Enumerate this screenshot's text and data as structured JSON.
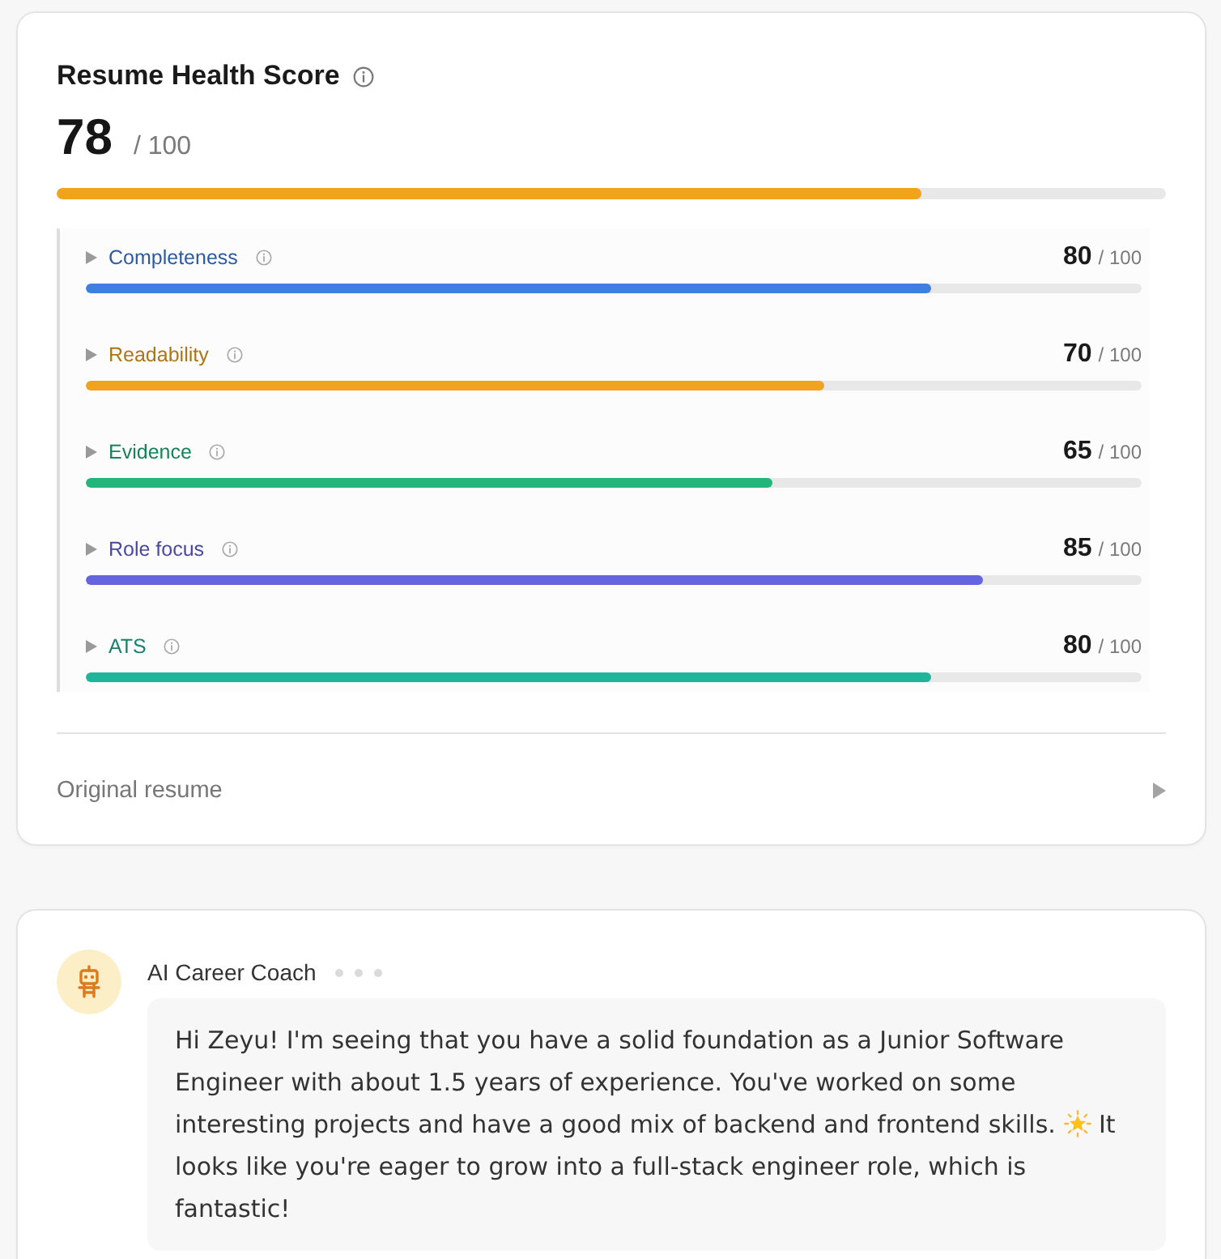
{
  "score_card": {
    "title": "Resume Health Score",
    "score": "78",
    "max": "/ 100",
    "level": 0.78,
    "categories": [
      {
        "name": "Completeness",
        "score": "80",
        "max": "/ 100",
        "level": 0.8,
        "color": "#3f7fe0",
        "expanded": false
      },
      {
        "name": "Readability",
        "score": "70",
        "max": "/ 100",
        "level": 0.7,
        "color": "#f0a320",
        "expanded": false
      },
      {
        "name": "Evidence",
        "score": "65",
        "max": "/ 100",
        "level": 0.65,
        "color": "#22b67b",
        "expanded": false
      },
      {
        "name": "Role focus",
        "score": "85",
        "max": "/ 100",
        "level": 0.85,
        "color": "#6565e0",
        "expanded": false
      },
      {
        "name": "ATS",
        "score": "80",
        "max": "/ 100",
        "level": 0.8,
        "color": "#20b49b",
        "expanded": false
      }
    ],
    "footer": {
      "label": "Original resume",
      "expanded": false
    }
  },
  "chat": {
    "sender": "AI Career Coach",
    "typing": true,
    "message": [
      {
        "kind": "text",
        "text": "Hi Zeyu! I'm seeing that you have a solid foundation as a Junior Software Engineer with about 1.5 years of experience. You've worked on some interesting projects and have a good mix of backend and frontend skills."
      },
      {
        "kind": "emoji"
      },
      {
        "kind": "text",
        "text": "It looks like you're eager to grow into a full-stack engineer role, which is fantastic!"
      }
    ]
  }
}
